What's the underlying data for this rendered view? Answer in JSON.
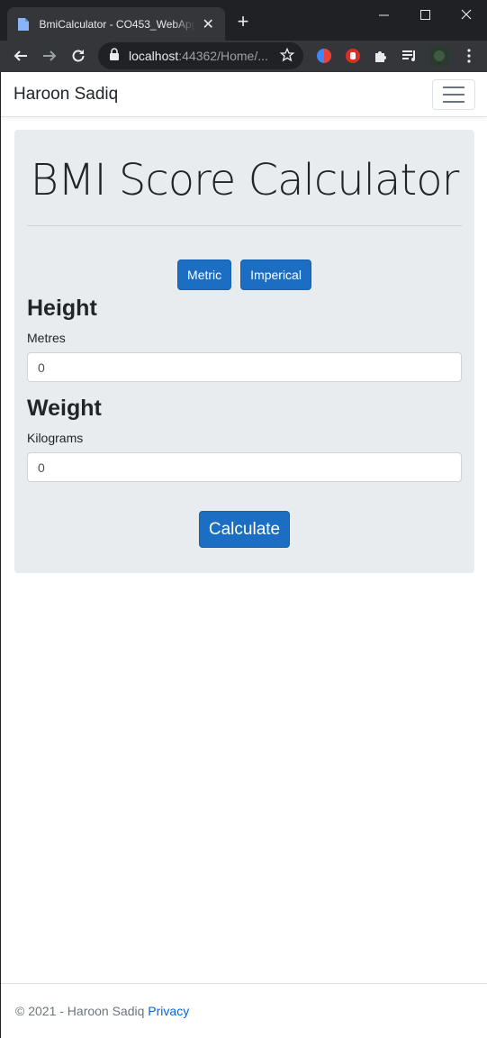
{
  "browser": {
    "tab_title": "BmiCalculator - CO453_WebApp",
    "url_host": "localhost",
    "url_rest": ":44362/Home/...",
    "new_tab_label": "+",
    "tab_close": "✕"
  },
  "navbar": {
    "brand": "Haroon Sadiq"
  },
  "main": {
    "title": "BMI Score Calculator",
    "metric_button": "Metric",
    "imperial_button": "Imperical",
    "height_heading": "Height",
    "height_unit": "Metres",
    "height_value": "0",
    "weight_heading": "Weight",
    "weight_unit": "Kilograms",
    "weight_value": "0",
    "calculate_button": "Calculate"
  },
  "footer": {
    "copyright": "© 2021 - Haroon Sadiq ",
    "privacy_link": "Privacy"
  },
  "colors": {
    "primary_button": "#1b6ec2",
    "jumbotron_bg": "#e9ecef",
    "browser_dark": "#202124"
  }
}
